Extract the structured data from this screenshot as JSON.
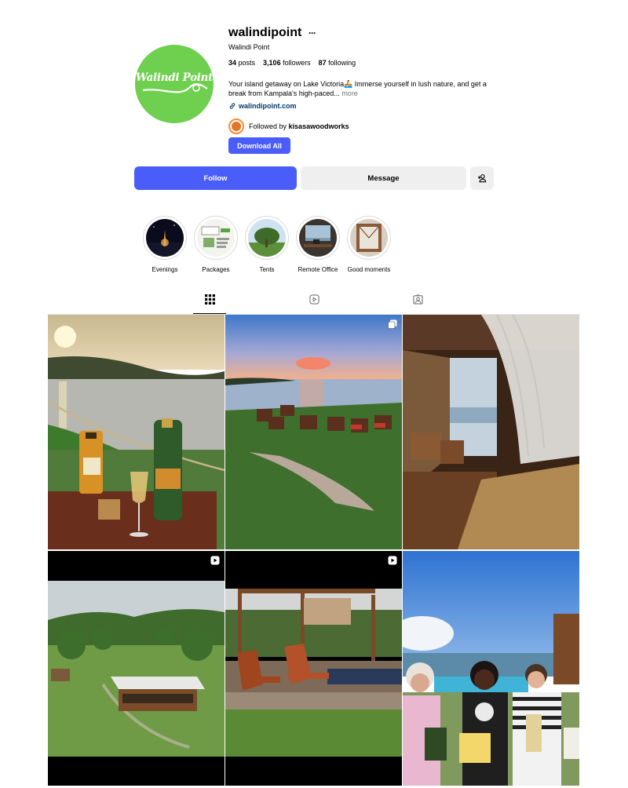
{
  "profile": {
    "avatar_text": "Walindi Point",
    "username": "walindipoint",
    "more_label": "···",
    "full_name": "Walindi Point",
    "stats": {
      "posts_count": "34",
      "posts_label": "posts",
      "followers_count": "3,106",
      "followers_label": "followers",
      "following_count": "87",
      "following_label": "following"
    },
    "bio": "Your island getaway on Lake Victoria🚣 Immerse yourself in lush nature, and get a break from Kampala's high-paced...",
    "bio_more": "more",
    "website": "walindipoint.com",
    "followed_by_prefix": "Followed by",
    "followed_by_user": "kisasawoodworks",
    "download_label": "Download All"
  },
  "actions": {
    "follow_label": "Follow",
    "message_label": "Message"
  },
  "highlights": [
    {
      "label": "Evenings"
    },
    {
      "label": "Packages"
    },
    {
      "label": "Tents"
    },
    {
      "label": "Remote Office"
    },
    {
      "label": "Good moments"
    }
  ],
  "tabs": [
    {
      "name": "posts",
      "icon": "grid-icon",
      "active": true
    },
    {
      "name": "reels",
      "icon": "reels-icon",
      "active": false
    },
    {
      "name": "tagged",
      "icon": "tagged-icon",
      "active": false
    }
  ],
  "posts": [
    {
      "subject": "lake sunset drinks",
      "badge": null
    },
    {
      "subject": "sunset chairs on lawn",
      "badge": "carousel-icon"
    },
    {
      "subject": "tent interior lake view",
      "badge": null
    },
    {
      "subject": "aerial cabin",
      "badge": "reel-icon"
    },
    {
      "subject": "deck chairs pool",
      "badge": "reel-icon"
    },
    {
      "subject": "guests with books",
      "badge": null
    }
  ],
  "colors": {
    "accent": "#4a5df9",
    "avatar_green": "#6fcf4e",
    "button_gray": "#efefef",
    "link": "#00376b"
  }
}
